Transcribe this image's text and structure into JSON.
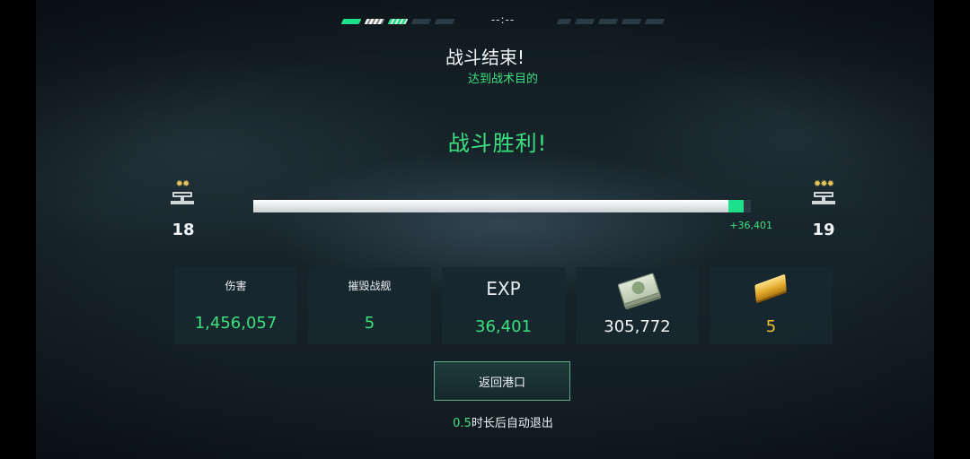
{
  "header": {
    "timer": "--:--"
  },
  "result": {
    "title": "战斗结束!",
    "subtitle": "达到战术目的",
    "victory": "战斗胜利!"
  },
  "rank": {
    "current_level": "18",
    "next_level": "19",
    "current_stars": "✹✹",
    "next_stars": "✹✹✹",
    "progress": 0.985,
    "gained_fraction": 0.03,
    "exp_gain_label": "+36,401"
  },
  "stats": [
    {
      "label": "伤害",
      "value": "1,456,057"
    },
    {
      "label": "摧毁战舰",
      "value": "5"
    },
    {
      "label": "EXP",
      "value": "36,401"
    },
    {
      "label": "",
      "value": "305,772",
      "icon": "money-icon"
    },
    {
      "label": "",
      "value": "5",
      "icon": "gold-bar-icon"
    }
  ],
  "actions": {
    "return_label": "返回港口"
  },
  "auto_exit": {
    "seconds": "0.5",
    "text": "时长后自动退出"
  },
  "colors": {
    "accent_green": "#3be07e",
    "gold": "#f2c12e"
  }
}
